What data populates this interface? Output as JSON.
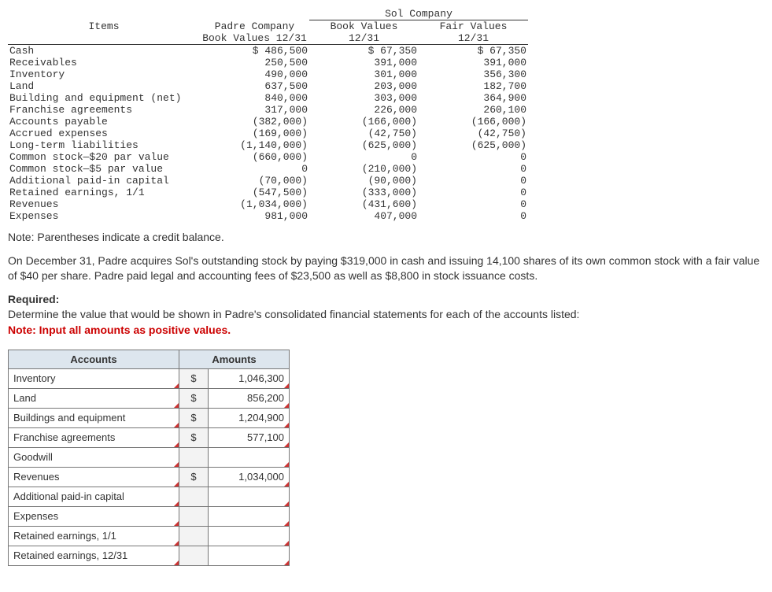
{
  "sol_header": "Sol Company",
  "col_headers": {
    "items": "Items",
    "padre_line1": "Padre Company",
    "padre_line2": "Book Values 12/31",
    "sol_book_line1": "Book Values",
    "sol_book_line2": "12/31",
    "sol_fair_line1": "Fair Values",
    "sol_fair_line2": "12/31"
  },
  "rows": [
    {
      "item": "Cash",
      "padre": "$ 486,500",
      "book": "$ 67,350",
      "fair": "$ 67,350"
    },
    {
      "item": "Receivables",
      "padre": "250,500",
      "book": "391,000",
      "fair": "391,000"
    },
    {
      "item": "Inventory",
      "padre": "490,000",
      "book": "301,000",
      "fair": "356,300"
    },
    {
      "item": "Land",
      "padre": "637,500",
      "book": "203,000",
      "fair": "182,700"
    },
    {
      "item": "Building and equipment (net)",
      "padre": "840,000",
      "book": "303,000",
      "fair": "364,900"
    },
    {
      "item": "Franchise agreements",
      "padre": "317,000",
      "book": "226,000",
      "fair": "260,100"
    },
    {
      "item": "Accounts payable",
      "padre": "(382,000)",
      "book": "(166,000)",
      "fair": "(166,000)"
    },
    {
      "item": "Accrued expenses",
      "padre": "(169,000)",
      "book": "(42,750)",
      "fair": "(42,750)"
    },
    {
      "item": "Long-term liabilities",
      "padre": "(1,140,000)",
      "book": "(625,000)",
      "fair": "(625,000)"
    },
    {
      "item": "Common stock—$20 par value",
      "padre": "(660,000)",
      "book": "0",
      "fair": "0"
    },
    {
      "item": "Common stock—$5 par value",
      "padre": "0",
      "book": "(210,000)",
      "fair": "0"
    },
    {
      "item": "Additional paid-in capital",
      "padre": "(70,000)",
      "book": "(90,000)",
      "fair": "0"
    },
    {
      "item": "Retained earnings, 1/1",
      "padre": "(547,500)",
      "book": "(333,000)",
      "fair": "0"
    },
    {
      "item": "Revenues",
      "padre": "(1,034,000)",
      "book": "(431,600)",
      "fair": "0"
    },
    {
      "item": "Expenses",
      "padre": "981,000",
      "book": "407,000",
      "fair": "0"
    }
  ],
  "note_parentheses": "Note: Parentheses indicate a credit balance.",
  "paragraph": "On December 31, Padre acquires Sol's outstanding stock by paying $319,000 in cash and issuing 14,100 shares of its own common stock with a fair value of $40 per share. Padre paid legal and accounting fees of $23,500 as well as $8,800 in stock issuance costs.",
  "required_label": "Required:",
  "required_text": "Determine the value that would be shown in Padre's consolidated financial statements for each of the accounts listed:",
  "note_positive": "Note: Input all amounts as positive values.",
  "answer_headers": {
    "accounts": "Accounts",
    "amounts": "Amounts"
  },
  "answer_rows": [
    {
      "label": "Inventory",
      "dollar": "$",
      "amount": "1,046,300"
    },
    {
      "label": "Land",
      "dollar": "$",
      "amount": "856,200"
    },
    {
      "label": "Buildings and equipment",
      "dollar": "$",
      "amount": "1,204,900"
    },
    {
      "label": "Franchise agreements",
      "dollar": "$",
      "amount": "577,100"
    },
    {
      "label": "Goodwill",
      "dollar": "",
      "amount": ""
    },
    {
      "label": "Revenues",
      "dollar": "$",
      "amount": "1,034,000"
    },
    {
      "label": "Additional paid-in capital",
      "dollar": "",
      "amount": ""
    },
    {
      "label": "Expenses",
      "dollar": "",
      "amount": ""
    },
    {
      "label": "Retained earnings, 1/1",
      "dollar": "",
      "amount": ""
    },
    {
      "label": "Retained earnings, 12/31",
      "dollar": "",
      "amount": ""
    }
  ]
}
